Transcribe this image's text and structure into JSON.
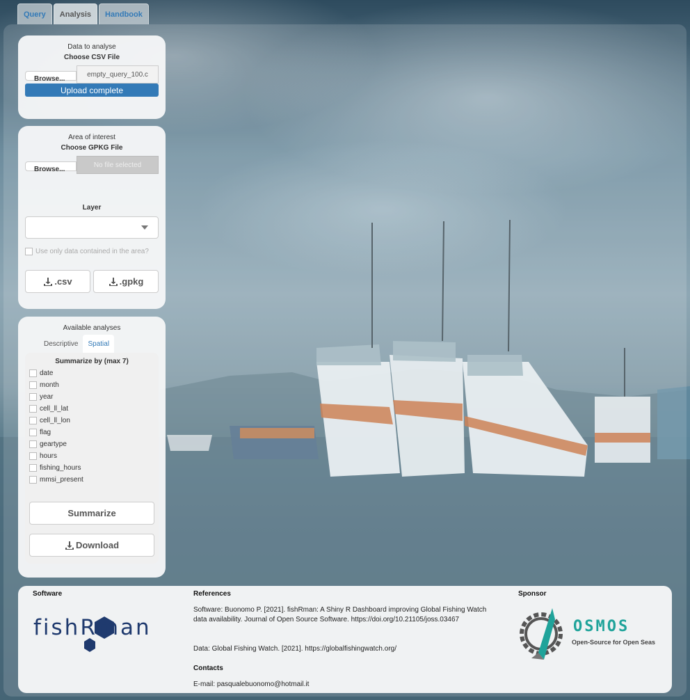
{
  "tabs": [
    "Query",
    "Analysis",
    "Handbook"
  ],
  "active_tab": "Analysis",
  "data_panel": {
    "title": "Data to analyse",
    "subtitle": "Choose CSV File",
    "browse_label": "Browse...",
    "file_name": "empty_query_100.c",
    "progress_label": "Upload complete",
    "progress": 1.0
  },
  "area_panel": {
    "title": "Area of interest",
    "subtitle": "Choose GPKG File",
    "browse_label": "Browse...",
    "file_placeholder": "No file selected",
    "layer_label": "Layer",
    "layer_value": "",
    "checkbox_label": "Use only data contained in the area?",
    "csv_button": ".csv",
    "gpkg_button": ".gpkg"
  },
  "analyses_panel": {
    "title": "Available analyses",
    "tabs": [
      "Descriptive",
      "Spatial"
    ],
    "active_tab": "Spatial",
    "summarize_title": "Summarize by (max 7)",
    "variables": [
      "date",
      "month",
      "year",
      "cell_ll_lat",
      "cell_ll_lon",
      "flag",
      "geartype",
      "hours",
      "fishing_hours",
      "mmsi_present"
    ],
    "summarize_button": "Summarize",
    "download_button": "Download"
  },
  "footer": {
    "software_heading": "Software",
    "logo_text": "fishRman",
    "references_heading": "References",
    "reference_software": "Software: Buonomo P. [2021]. fishRman: A Shiny R Dashboard improving Global Fishing Watch data availability. Journal of Open Source Software. https://doi.org/10.21105/joss.03467",
    "reference_data": "Data: Global Fishing Watch. [2021]. https://globalfishingwatch.org/",
    "contacts_heading": "Contacts",
    "email": "E-mail: pasqualebuonomo@hotmail.it",
    "sponsor_heading": "Sponsor",
    "sponsor_name": "OSMOS",
    "sponsor_tagline": "Open-Source for Open Seas"
  },
  "colors": {
    "accent": "#337ab7",
    "logo_navy": "#1f3a6e",
    "osmos_teal": "#1fa39a"
  }
}
